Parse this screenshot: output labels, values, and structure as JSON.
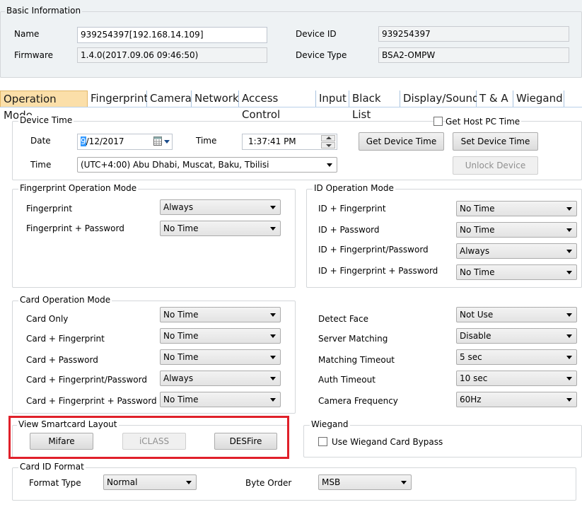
{
  "basic_info": {
    "title": "Basic Information",
    "name_label": "Name",
    "name_value": "939254397[192.168.14.109]",
    "firmware_label": "Firmware",
    "firmware_value": "1.4.0(2017.09.06 09:46:50)",
    "device_id_label": "Device ID",
    "device_id_value": "939254397",
    "device_type_label": "Device Type",
    "device_type_value": "BSA2-OMPW"
  },
  "tabs": [
    "Operation Mode",
    "Fingerprint",
    "Camera",
    "Network",
    "Access Control",
    "Input",
    "Black List",
    "Display/Sound",
    "T & A",
    "Wiegand"
  ],
  "device_time": {
    "title": "Device Time",
    "date_label": "Date",
    "date_sel": "9",
    "date_rest": "/12/2017",
    "time_label": "Time",
    "time_value": "1:37:41 PM",
    "zone_label": "Time",
    "zone_value": "(UTC+4:00) Abu Dhabi, Muscat, Baku, Tbilisi",
    "get_host_pc_time": "Get Host PC Time",
    "get_device_time": "Get Device Time",
    "set_device_time": "Set Device Time",
    "unlock_device": "Unlock Device"
  },
  "fingerprint_mode": {
    "title": "Fingerprint Operation Mode",
    "rows": [
      {
        "label": "Fingerprint",
        "value": "Always"
      },
      {
        "label": "Fingerprint + Password",
        "value": "No Time"
      }
    ]
  },
  "id_mode": {
    "title": "ID Operation Mode",
    "rows": [
      {
        "label": "ID + Fingerprint",
        "value": "No Time"
      },
      {
        "label": "ID + Password",
        "value": "No Time"
      },
      {
        "label": "ID + Fingerprint/Password",
        "value": "Always"
      },
      {
        "label": "ID + Fingerprint + Password",
        "value": "No Time"
      }
    ]
  },
  "card_mode": {
    "title": "Card Operation Mode",
    "rows": [
      {
        "label": "Card Only",
        "value": "No Time"
      },
      {
        "label": "Card + Fingerprint",
        "value": "No Time"
      },
      {
        "label": "Card + Password",
        "value": "No Time"
      },
      {
        "label": "Card + Fingerprint/Password",
        "value": "Always"
      },
      {
        "label": "Card + Fingerprint + Password",
        "value": "No Time"
      }
    ]
  },
  "misc": {
    "rows": [
      {
        "label": "Detect Face",
        "value": "Not Use"
      },
      {
        "label": "Server Matching",
        "value": "Disable"
      },
      {
        "label": "Matching Timeout",
        "value": "5 sec"
      },
      {
        "label": "Auth Timeout",
        "value": "10 sec"
      },
      {
        "label": "Camera Frequency",
        "value": "60Hz"
      }
    ]
  },
  "smartcard": {
    "title": "View Smartcard Layout",
    "mifare": "Mifare",
    "iclass": "iCLASS",
    "desfire": "DESFire"
  },
  "wiegand": {
    "title": "Wiegand",
    "bypass_label": "Use Wiegand Card Bypass"
  },
  "card_id_format": {
    "title": "Card ID Format",
    "format_label": "Format Type",
    "format_value": "Normal",
    "byte_order_label": "Byte Order",
    "byte_order_value": "MSB"
  },
  "colors": {
    "active_tab": "#fbdfa9",
    "highlight": "#e0202a",
    "info_bg": "#eef2f4"
  }
}
